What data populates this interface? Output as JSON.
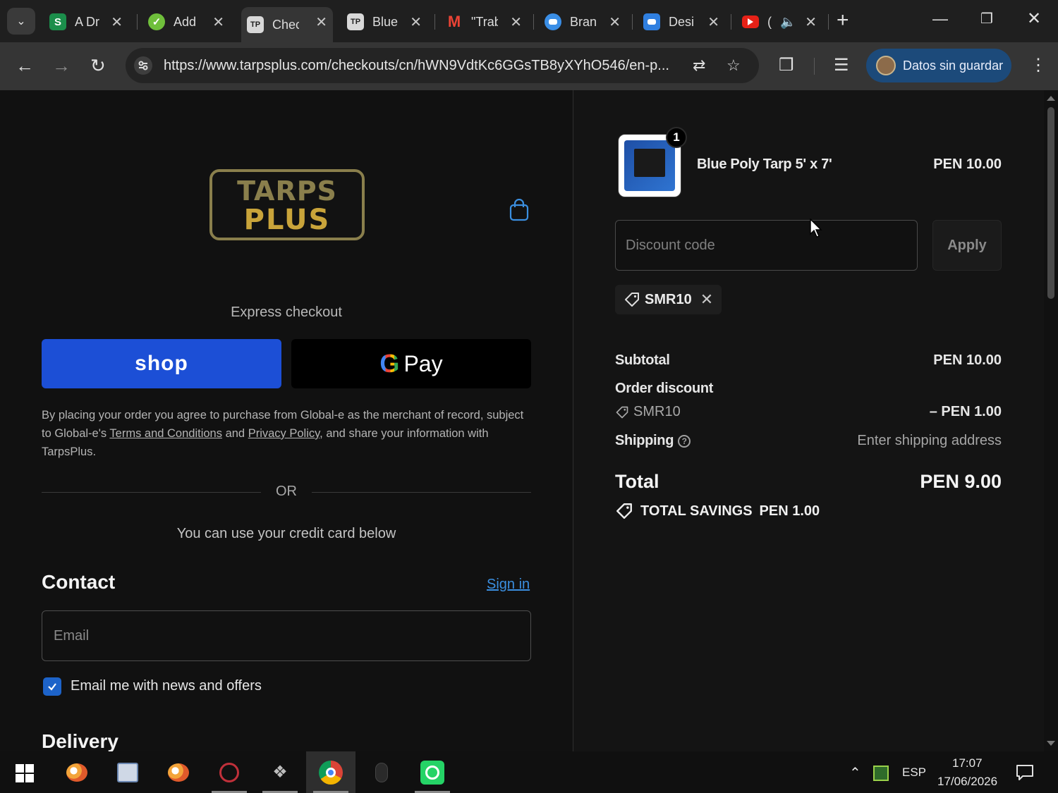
{
  "browser": {
    "tabs": [
      {
        "title": "A Dr",
        "favicon": "S",
        "favicon_color": "#1b8e4b"
      },
      {
        "title": "Add",
        "favicon": "✓",
        "favicon_color": "#6fbf3b"
      },
      {
        "title": "Chec",
        "favicon": "TP",
        "favicon_color": "#d8d8d8",
        "active": true
      },
      {
        "title": "Blue",
        "favicon": "TP",
        "favicon_color": "#d8d8d8"
      },
      {
        "title": "\"Trab",
        "favicon": "M",
        "favicon_color": "#ea4335"
      },
      {
        "title": "Bran",
        "favicon": "chat",
        "favicon_color": "#3a8ee6"
      },
      {
        "title": "Desi",
        "favicon": "chat",
        "favicon_color": "#2f7fe0"
      },
      {
        "title": "(",
        "favicon": "yt",
        "favicon_color": "#e62117"
      }
    ],
    "url": "https://www.tarpsplus.com/checkouts/cn/hWN9VdtKc6GGsTB8yXYhO546/en-p...",
    "profile_label": "Datos sin guardar"
  },
  "checkout": {
    "logo": {
      "line1": "TARPS",
      "line2": "PLUS"
    },
    "express_title": "Express checkout",
    "shop_label": "shop",
    "gpay_label": "Pay",
    "legal": {
      "part1": "By placing your order you agree to purchase from Global-e as the merchant of record, subject to Global-e's ",
      "terms": "Terms and Conditions",
      "part2": " and ",
      "privacy": "Privacy Policy",
      "part3": ", and share your information with TarpsPlus."
    },
    "or_label": "OR",
    "credit_note": "You can use your credit card below",
    "contact_heading": "Contact",
    "signin_label": "Sign in",
    "email_placeholder": "Email",
    "news_label": "Email me with news and offers",
    "news_checked": true,
    "delivery_heading": "Delivery"
  },
  "summary": {
    "item": {
      "name": "Blue Poly Tarp 5' x 7'",
      "price": "PEN 10.00",
      "quantity": "1"
    },
    "discount_placeholder": "Discount code",
    "apply_label": "Apply",
    "applied_code": "SMR10",
    "subtotal_label": "Subtotal",
    "subtotal_value": "PEN 10.00",
    "order_discount_label": "Order discount",
    "discount_code": "SMR10",
    "discount_value": "– PEN 1.00",
    "shipping_label": "Shipping",
    "shipping_value": "Enter shipping address",
    "total_label": "Total",
    "total_value": "PEN 9.00",
    "savings_label": "TOTAL SAVINGS",
    "savings_value": "PEN 1.00"
  },
  "taskbar": {
    "language": "ESP",
    "time": "17:07",
    "date": "17/06/2026"
  },
  "colors": {
    "shop_blue": "#1c4fd6",
    "link_blue": "#3b8fe0",
    "check_blue": "#1d63c9",
    "logo_gold": "#c9a43a"
  }
}
